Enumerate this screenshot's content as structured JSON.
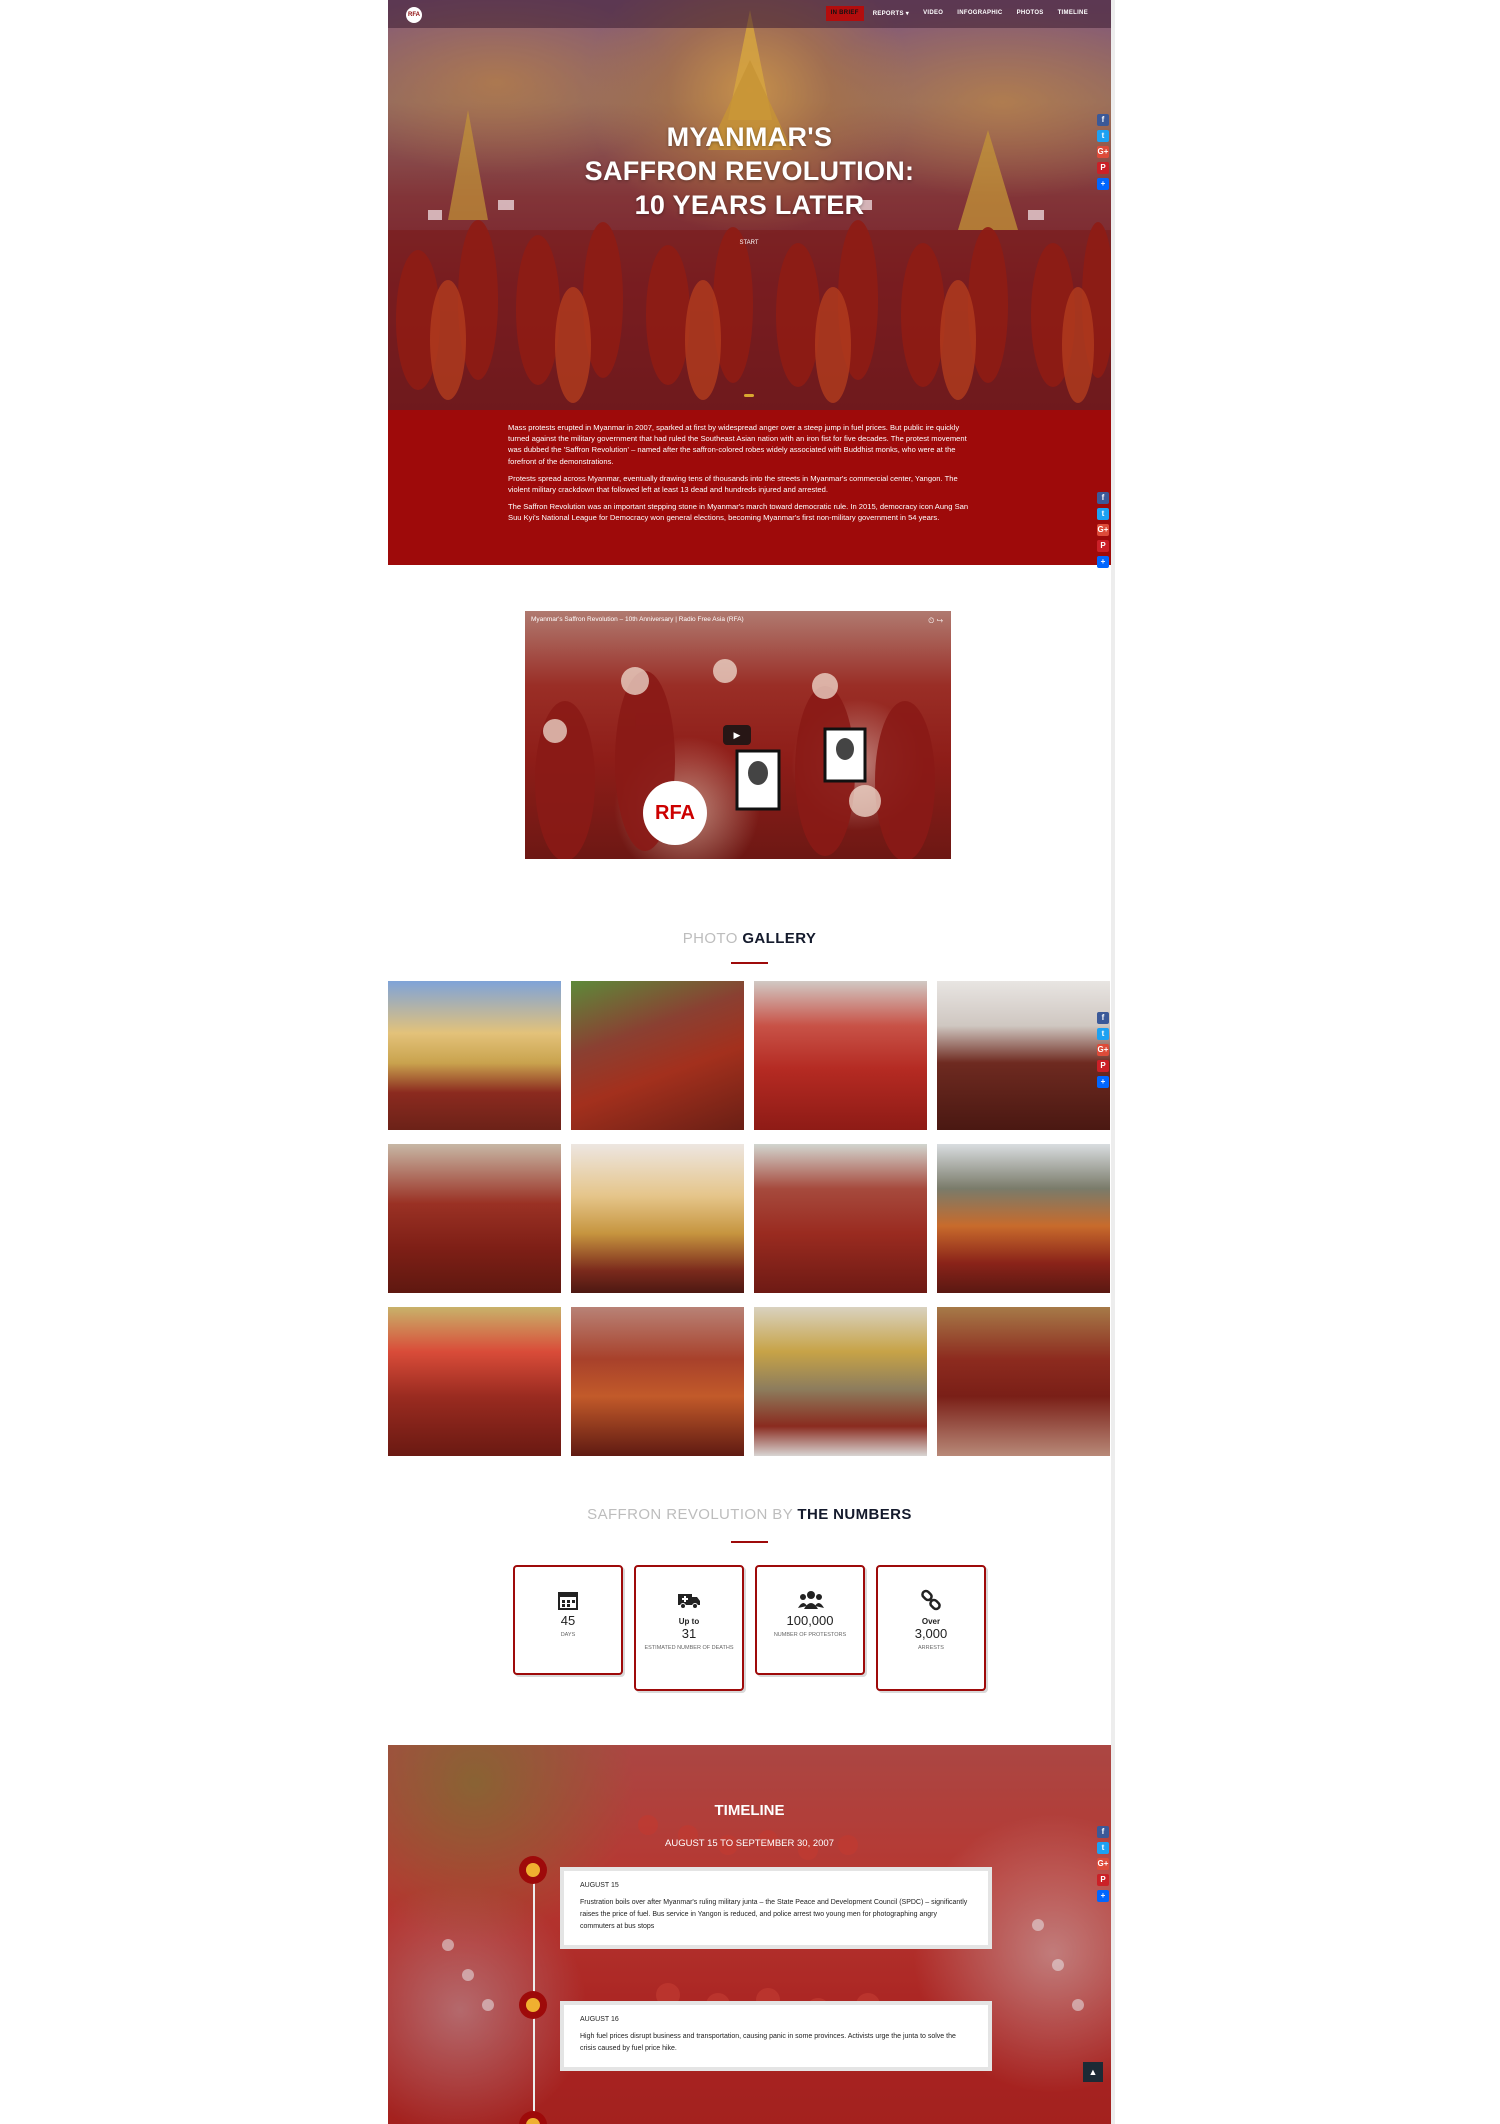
{
  "nav": {
    "logo": "RFA",
    "items": [
      {
        "label": "IN BRIEF",
        "active": true
      },
      {
        "label": "REPORTS ▾",
        "active": false
      },
      {
        "label": "VIDEO",
        "active": false
      },
      {
        "label": "INFOGRAPHIC",
        "active": false
      },
      {
        "label": "PHOTOS",
        "active": false
      },
      {
        "label": "TIMELINE",
        "active": false
      }
    ]
  },
  "hero": {
    "title_line1": "MYANMAR'S",
    "title_line2": "SAFFRON REVOLUTION:",
    "title_line3": "10 YEARS LATER",
    "start_label": "START"
  },
  "intro": {
    "paragraphs": [
      "Mass protests erupted in Myanmar in 2007, sparked at first by widespread anger over a steep jump in fuel prices. But public ire quickly turned against the military government that had ruled the Southeast Asian nation with an iron fist for five decades. The protest movement was dubbed the 'Saffron Revolution' – named after the saffron-colored robes widely associated with Buddhist monks, who were at the forefront of the demonstrations.",
      "Protests spread across Myanmar, eventually drawing tens of thousands into the streets in Myanmar's commercial center, Yangon. The violent military crackdown that followed left at least 13 dead and hundreds injured and arrested.",
      "The Saffron Revolution was an important stepping stone in Myanmar's march toward democratic rule. In 2015, democracy icon Aung San Suu Kyi's National League for Democracy won general elections, becoming Myanmar's first non-military government in 54 years."
    ]
  },
  "video": {
    "title": "Myanmar's Saffron Revolution – 10th Anniversary | Radio Free Asia (RFA)",
    "logo": "RFA"
  },
  "gallery": {
    "title_light": "PHOTO",
    "title_bold": "GALLERY"
  },
  "numbers": {
    "title_light": "SAFFRON REVOLUTION BY",
    "title_bold": "THE NUMBERS",
    "stats": [
      {
        "prefix": "",
        "value": "45",
        "label": "DAYS",
        "icon": "calendar-icon"
      },
      {
        "prefix": "Up to",
        "value": "31",
        "label": "ESTIMATED NUMBER OF DEATHS",
        "icon": "ambulance-icon"
      },
      {
        "prefix": "",
        "value": "100,000",
        "label": "NUMBER OF PROTESTORS",
        "icon": "group-icon"
      },
      {
        "prefix": "Over",
        "value": "3,000",
        "label": "ARRESTS",
        "icon": "chain-icon"
      }
    ]
  },
  "timeline": {
    "title": "TIMELINE",
    "subtitle": "AUGUST 15 TO SEPTEMBER 30, 2007",
    "events": [
      {
        "date": "AUGUST 15",
        "text": "Frustration boils over after Myanmar's ruling military junta – the State Peace and Development Council (SPDC) – significantly raises the price of fuel. Bus service in Yangon is reduced, and police arrest two young men for photographing angry commuters at bus stops"
      },
      {
        "date": "AUGUST 16",
        "text": "High fuel prices disrupt business and transportation, causing panic in some provinces. Activists urge the junta to solve the crisis caused by fuel price hike."
      }
    ]
  },
  "share": {
    "fb": "f",
    "tw": "t",
    "gp": "G+",
    "pi": "P",
    "ad": "+"
  },
  "colors": {
    "accent": "#9e0a0a",
    "dark_heading": "#141a2c",
    "light_heading": "#bdbdbd"
  }
}
